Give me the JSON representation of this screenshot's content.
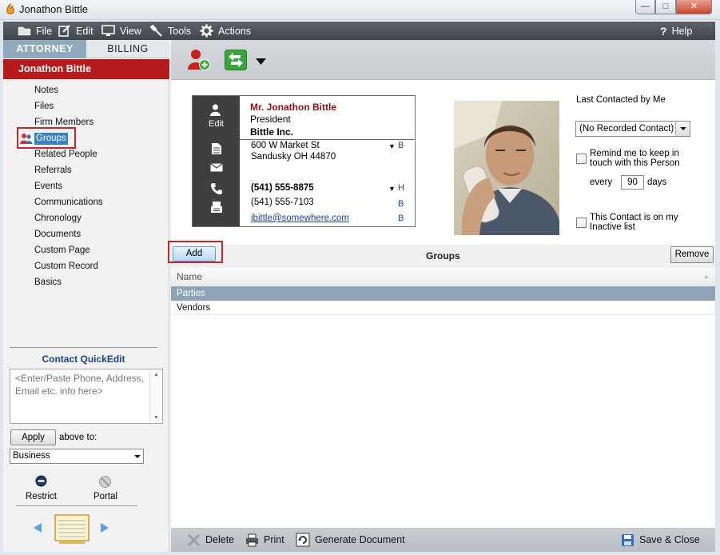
{
  "window": {
    "title": "Jonathon Bittle",
    "minimize": "0",
    "maximize": "1",
    "close": "r"
  },
  "menu": {
    "file": "File",
    "edit": "Edit",
    "view": "View",
    "tools": "Tools",
    "actions": "Actions",
    "help": "Help"
  },
  "tabs": {
    "attorney": "ATTORNEY",
    "billing": "BILLING"
  },
  "contact_header": "Jonathon Bittle",
  "nav": {
    "items": [
      "Notes",
      "Files",
      "Firm Members",
      "Groups",
      "Related People",
      "Referrals",
      "Events",
      "Communications",
      "Chronology",
      "Documents",
      "Custom Page",
      "Custom Record",
      "Basics"
    ],
    "selected": "Groups"
  },
  "quickedit": {
    "title": "Contact QuickEdit",
    "placeholder": "<Enter/Paste Phone, Address, Email etc. info here>",
    "apply": "Apply",
    "above_to": "above to:",
    "target": "Business"
  },
  "footer_left": {
    "restrict": "Restrict",
    "portal": "Portal"
  },
  "card": {
    "edit": "Edit",
    "name": "Mr. Jonathon Bittle",
    "title": "President",
    "company": "Bittle Inc.",
    "address1": "600 W Market St",
    "address2": "Sandusky OH 44870",
    "address_tag": "B",
    "phone1": "(541) 555-8875",
    "phone1_tag": "H",
    "phone2": "(541) 555-7103",
    "phone2_tag": "B",
    "email": "jbittle@somewhere.com",
    "email_tag": "B"
  },
  "contact_settings": {
    "last_contacted_label": "Last Contacted by Me",
    "last_contacted_value": "(No Recorded Contact)",
    "remind_label": "Remind me to keep in touch with this Person",
    "every": "every",
    "days_value": "90",
    "days": "days",
    "inactive_label": "This Contact is on my Inactive list"
  },
  "groups": {
    "add": "Add",
    "title": "Groups",
    "remove": "Remove",
    "column": "Name",
    "rows": [
      "Parties",
      "Vendors"
    ]
  },
  "bottom": {
    "delete": "Delete",
    "print": "Print",
    "generate": "Generate Document",
    "save_close": "Save & Close"
  },
  "colors": {
    "accent_red": "#b51b1b",
    "menu_bg": "#4a4f55",
    "tab_active": "#8fa9bd",
    "selected_row": "#8ea4b6",
    "link_blue": "#1b3ea0"
  }
}
